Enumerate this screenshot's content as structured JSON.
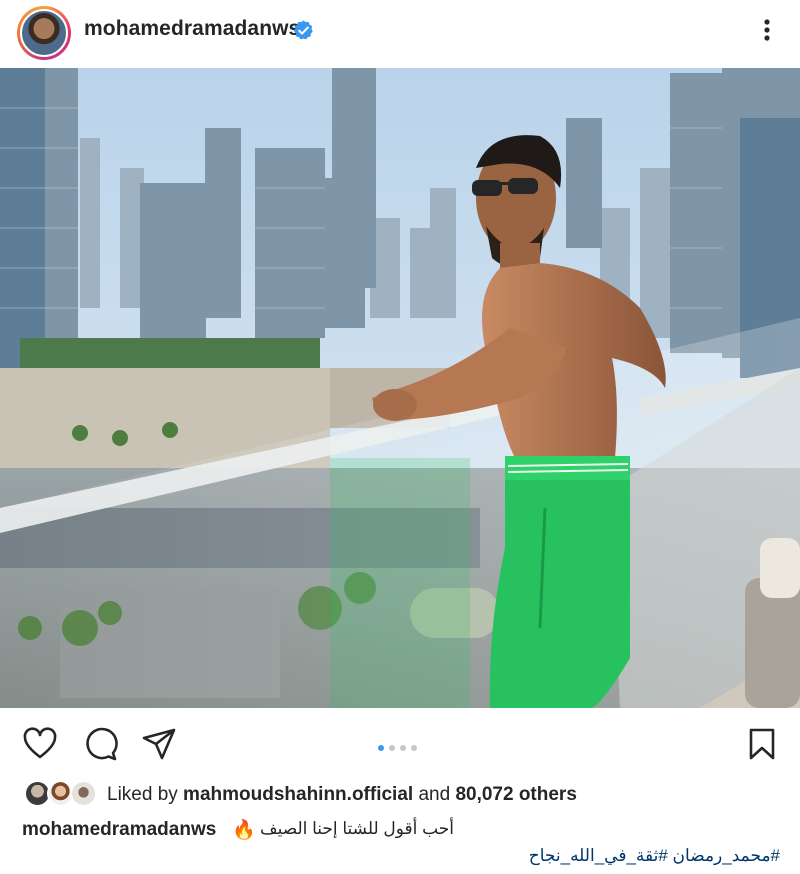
{
  "post": {
    "username": "mohamedramadanws",
    "verified": true,
    "more_icon": "more-vertical-icon"
  },
  "photo": {
    "description_icon": "post-photo"
  },
  "actions": {
    "like_icon": "heart-icon",
    "comment_icon": "comment-icon",
    "share_icon": "send-icon",
    "save_icon": "bookmark-icon",
    "carousel": {
      "count": 4,
      "active": 0
    }
  },
  "likes": {
    "prefix": "Liked by ",
    "liker": "mahmoudshahinn.official",
    "suffix": " and ",
    "others": "80,072 others"
  },
  "caption": {
    "username": "mohamedramadanws",
    "emoji": "🔥",
    "text": "أحب أقول للشتا إحنا الصيف",
    "hashtags": "#محمد_رمضان #ثقة_في_الله_نجاح"
  },
  "colors": {
    "accent": "#3897f0",
    "hashtag": "#00376b",
    "text": "#262626"
  }
}
